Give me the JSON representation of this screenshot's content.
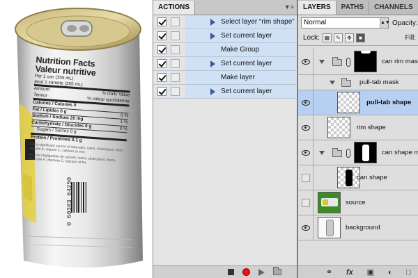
{
  "actions_panel": {
    "tab_label": "ACTIONS",
    "items": [
      {
        "label": "Select layer “rim shape”",
        "checked": true,
        "expandable": true
      },
      {
        "label": "Set current layer",
        "checked": true,
        "expandable": true
      },
      {
        "label": "Make Group",
        "checked": true,
        "expandable": false
      },
      {
        "label": "Set current layer",
        "checked": true,
        "expandable": true
      },
      {
        "label": "Make layer",
        "checked": true,
        "expandable": false
      },
      {
        "label": "Set current layer",
        "checked": true,
        "expandable": true
      }
    ],
    "bottom_buttons": [
      "stop-icon",
      "record-icon",
      "play-icon",
      "folder-icon"
    ]
  },
  "layers_panel": {
    "tabs": [
      "LAYERS",
      "PATHS",
      "CHANNELS"
    ],
    "blend_mode": "Normal",
    "opacity_label": "Opacity:",
    "lock_label": "Lock:",
    "fill_label": "Fill:",
    "layers": [
      {
        "name": "can rim mask",
        "visible": true,
        "group": true,
        "expanded": true,
        "indent": 0,
        "thumb": "mask-black",
        "selected": false
      },
      {
        "name": "pull-tab mask",
        "visible": false,
        "group": true,
        "expanded": true,
        "indent": 1,
        "thumb": "none",
        "selected": false
      },
      {
        "name": "pull-tab shape",
        "visible": true,
        "group": false,
        "indent": 2,
        "thumb": "checker",
        "selected": true
      },
      {
        "name": "rim shape",
        "visible": true,
        "group": false,
        "indent": 0,
        "thumb": "checker",
        "selected": false
      },
      {
        "name": "can shape m",
        "visible": true,
        "group": true,
        "expanded": true,
        "indent": 0,
        "thumb": "mask-can",
        "selected": false
      },
      {
        "name": "can shape",
        "visible": false,
        "group": false,
        "indent": 1,
        "thumb": "checker-can",
        "selected": false
      },
      {
        "name": "source",
        "visible": false,
        "group": false,
        "indent": 0,
        "thumb": "green",
        "selected": false
      },
      {
        "name": "background",
        "visible": true,
        "group": false,
        "indent": 0,
        "thumb": "can-photo",
        "selected": false
      }
    ],
    "bottom_icons": [
      "link-icon",
      "fx-icon",
      "mask-icon",
      "adjustment-icon",
      "folder-icon"
    ],
    "fx_label": "fx"
  },
  "photo": {
    "label_title_en": "Nutrition Facts",
    "label_title_fr": "Valeur nutritive",
    "serving_en": "Per 1 can (355 mL)",
    "serving_fr": "pour 1 canette (355 mL)",
    "header_left": "Amount",
    "header_left_fr": "Teneur",
    "header_right": "% Daily Value",
    "header_right_fr": "% valeur quotidienne",
    "rows": [
      {
        "label": "Calories / Calories 0",
        "value": ""
      },
      {
        "label": "Fat / Lipides 0 g",
        "value": "0 %"
      },
      {
        "label": "Sodium / Sodium 20 mg",
        "value": "1 %"
      },
      {
        "label": "Carbohydrate / Glucides 0 g",
        "value": "0 %"
      },
      {
        "label": "Sugars / Sucres 0 g",
        "value": ""
      },
      {
        "label": "Protein / Protéines 0.1 g",
        "value": ""
      }
    ],
    "foot_en": "Not a significant source of saturates, trans, cholesterol, fibre, vitamin A, vitamin C, calcium or iron.",
    "foot_fr": "Source négligeable de saturés, trans, cholestérol, fibres, vitamine A, vitamine C, calcium et fer.",
    "barcode": "0 60383 64250"
  }
}
